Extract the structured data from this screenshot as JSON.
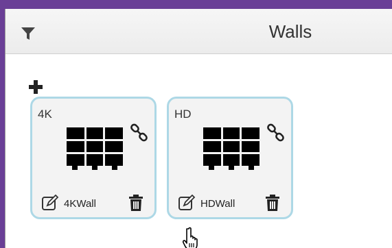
{
  "header": {
    "title": "Walls",
    "filter_icon": "filter-icon"
  },
  "toolbar": {
    "add_icon": "plus-icon"
  },
  "walls": [
    {
      "resolution": "4K",
      "name": "4KWall"
    },
    {
      "resolution": "HD",
      "name": "HDWall"
    }
  ],
  "colors": {
    "window_frame": "#6a3f96",
    "card_border": "#add8e6",
    "card_background": "#f3f3f3",
    "header_background": "#ececec"
  }
}
